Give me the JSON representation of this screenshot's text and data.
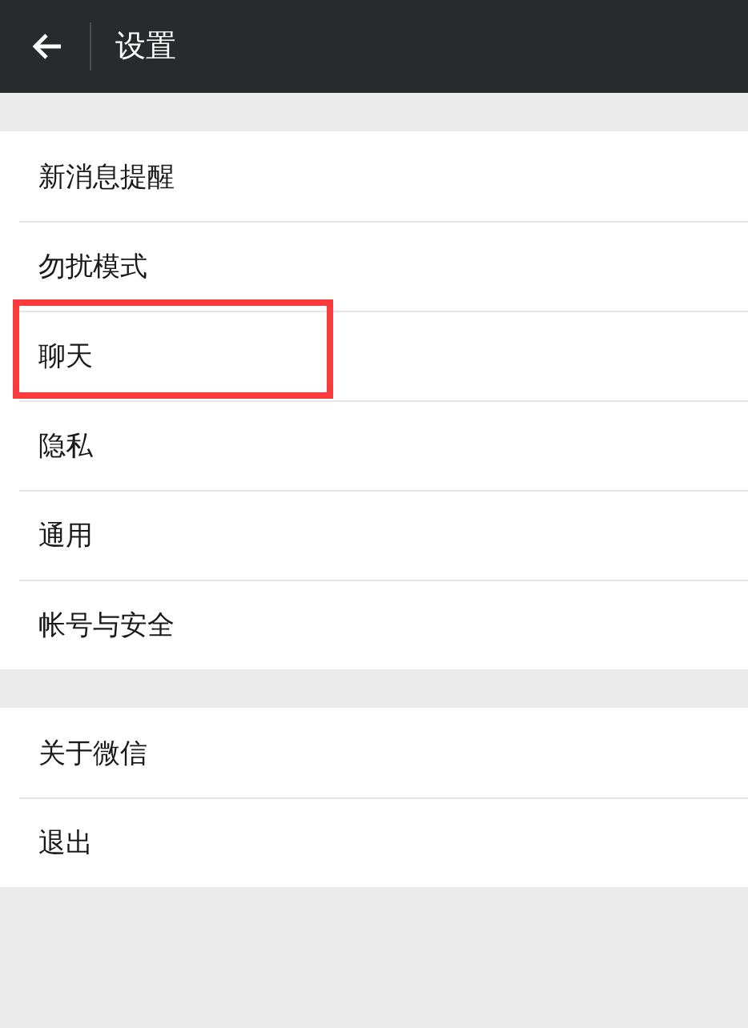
{
  "header": {
    "title": "设置"
  },
  "groups": [
    {
      "items": [
        {
          "label": "新消息提醒",
          "highlighted": false
        },
        {
          "label": "勿扰模式",
          "highlighted": false
        },
        {
          "label": "聊天",
          "highlighted": true
        },
        {
          "label": "隐私",
          "highlighted": false
        },
        {
          "label": "通用",
          "highlighted": false
        },
        {
          "label": "帐号与安全",
          "highlighted": false
        }
      ]
    },
    {
      "items": [
        {
          "label": "关于微信",
          "highlighted": false
        },
        {
          "label": "退出",
          "highlighted": false
        }
      ]
    }
  ]
}
